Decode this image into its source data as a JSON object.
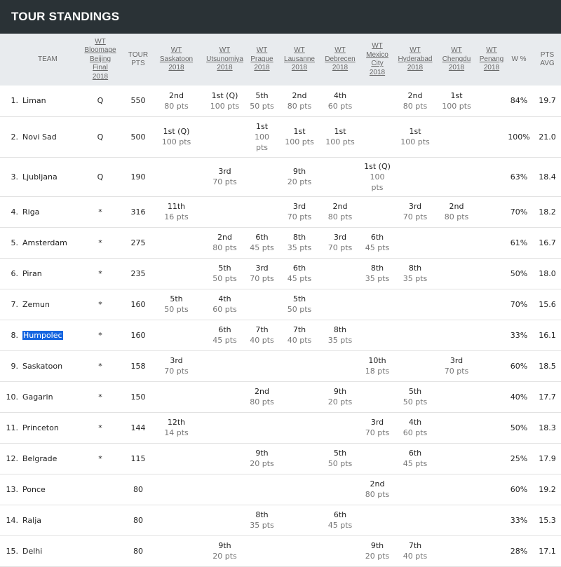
{
  "title": "TOUR STANDINGS",
  "columns": {
    "team": "TEAM",
    "bloomage": [
      "WT",
      "Bloomage",
      "Beijing",
      "Final",
      "2018"
    ],
    "tour_pts": [
      "TOUR",
      "PTS"
    ],
    "events": [
      [
        "WT",
        "Saskatoon",
        "2018"
      ],
      [
        "WT",
        "Utsunomiya",
        "2018"
      ],
      [
        "WT",
        "Prague",
        "2018"
      ],
      [
        "WT",
        "Lausanne",
        "2018"
      ],
      [
        "WT",
        "Debrecen",
        "2018"
      ],
      [
        "WT",
        "Mexico",
        "City",
        "2018"
      ],
      [
        "WT",
        "Hyderabad",
        "2018"
      ],
      [
        "WT",
        "Chengdu",
        "2018"
      ],
      [
        "WT",
        "Penang",
        "2018"
      ]
    ],
    "win_pct": "W %",
    "pts_avg": [
      "PTS",
      "AVG"
    ]
  },
  "rows": [
    {
      "rank": "1.",
      "team": "Liman",
      "q": "Q",
      "tour": "550",
      "ev": [
        [
          "2nd",
          "80 pts"
        ],
        [
          "1st (Q)",
          "100 pts"
        ],
        [
          "5th",
          "50 pts"
        ],
        [
          "2nd",
          "80 pts"
        ],
        [
          "4th",
          "60 pts"
        ],
        null,
        [
          "2nd",
          "80 pts"
        ],
        [
          "1st",
          "100 pts"
        ],
        null
      ],
      "w": "84%",
      "avg": "19.7"
    },
    {
      "rank": "2.",
      "team": "Novi Sad",
      "q": "Q",
      "tour": "500",
      "ev": [
        [
          "1st (Q)",
          "100 pts"
        ],
        null,
        [
          "1st",
          "100",
          "pts"
        ],
        [
          "1st",
          "100 pts"
        ],
        [
          "1st",
          "100 pts"
        ],
        null,
        [
          "1st",
          "100 pts"
        ],
        null,
        null
      ],
      "w": "100%",
      "avg": "21.0"
    },
    {
      "rank": "3.",
      "team": "Ljubljana",
      "q": "Q",
      "tour": "190",
      "ev": [
        null,
        [
          "3rd",
          "70 pts"
        ],
        null,
        [
          "9th",
          "20 pts"
        ],
        null,
        [
          "1st (Q)",
          "100",
          "pts"
        ],
        null,
        null,
        null
      ],
      "w": "63%",
      "avg": "18.4"
    },
    {
      "rank": "4.",
      "team": "Riga",
      "q": "*",
      "tour": "316",
      "ev": [
        [
          "11th",
          "16 pts"
        ],
        null,
        null,
        [
          "3rd",
          "70 pts"
        ],
        [
          "2nd",
          "80 pts"
        ],
        null,
        [
          "3rd",
          "70 pts"
        ],
        [
          "2nd",
          "80 pts"
        ],
        null
      ],
      "w": "70%",
      "avg": "18.2"
    },
    {
      "rank": "5.",
      "team": "Amsterdam",
      "q": "*",
      "tour": "275",
      "ev": [
        null,
        [
          "2nd",
          "80 pts"
        ],
        [
          "6th",
          "45 pts"
        ],
        [
          "8th",
          "35 pts"
        ],
        [
          "3rd",
          "70 pts"
        ],
        [
          "6th",
          "45 pts"
        ],
        null,
        null,
        null
      ],
      "w": "61%",
      "avg": "16.7"
    },
    {
      "rank": "6.",
      "team": "Piran",
      "q": "*",
      "tour": "235",
      "ev": [
        null,
        [
          "5th",
          "50 pts"
        ],
        [
          "3rd",
          "70 pts"
        ],
        [
          "6th",
          "45 pts"
        ],
        null,
        [
          "8th",
          "35 pts"
        ],
        [
          "8th",
          "35 pts"
        ],
        null,
        null
      ],
      "w": "50%",
      "avg": "18.0"
    },
    {
      "rank": "7.",
      "team": "Zemun",
      "q": "*",
      "tour": "160",
      "ev": [
        [
          "5th",
          "50 pts"
        ],
        [
          "4th",
          "60 pts"
        ],
        null,
        [
          "5th",
          "50 pts"
        ],
        null,
        null,
        null,
        null,
        null
      ],
      "w": "70%",
      "avg": "15.6"
    },
    {
      "rank": "8.",
      "team": "Humpolec",
      "q": "*",
      "tour": "160",
      "ev": [
        null,
        [
          "6th",
          "45 pts"
        ],
        [
          "7th",
          "40 pts"
        ],
        [
          "7th",
          "40 pts"
        ],
        [
          "8th",
          "35 pts"
        ],
        null,
        null,
        null,
        null
      ],
      "w": "33%",
      "avg": "16.1"
    },
    {
      "rank": "9.",
      "team": "Saskatoon",
      "q": "*",
      "tour": "158",
      "ev": [
        [
          "3rd",
          "70 pts"
        ],
        null,
        null,
        null,
        null,
        [
          "10th",
          "18 pts"
        ],
        null,
        [
          "3rd",
          "70 pts"
        ],
        null
      ],
      "w": "60%",
      "avg": "18.5"
    },
    {
      "rank": "10.",
      "team": "Gagarin",
      "q": "*",
      "tour": "150",
      "ev": [
        null,
        null,
        [
          "2nd",
          "80 pts"
        ],
        null,
        [
          "9th",
          "20 pts"
        ],
        null,
        [
          "5th",
          "50 pts"
        ],
        null,
        null
      ],
      "w": "40%",
      "avg": "17.7"
    },
    {
      "rank": "11.",
      "team": "Princeton",
      "q": "*",
      "tour": "144",
      "ev": [
        [
          "12th",
          "14 pts"
        ],
        null,
        null,
        null,
        null,
        [
          "3rd",
          "70 pts"
        ],
        [
          "4th",
          "60 pts"
        ],
        null,
        null
      ],
      "w": "50%",
      "avg": "18.3"
    },
    {
      "rank": "12.",
      "team": "Belgrade",
      "q": "*",
      "tour": "115",
      "ev": [
        null,
        null,
        [
          "9th",
          "20 pts"
        ],
        null,
        [
          "5th",
          "50 pts"
        ],
        null,
        [
          "6th",
          "45 pts"
        ],
        null,
        null
      ],
      "w": "25%",
      "avg": "17.9"
    },
    {
      "rank": "13.",
      "team": "Ponce",
      "q": "",
      "tour": "80",
      "ev": [
        null,
        null,
        null,
        null,
        null,
        [
          "2nd",
          "80 pts"
        ],
        null,
        null,
        null
      ],
      "w": "60%",
      "avg": "19.2"
    },
    {
      "rank": "14.",
      "team": "Ralja",
      "q": "",
      "tour": "80",
      "ev": [
        null,
        null,
        [
          "8th",
          "35 pts"
        ],
        null,
        [
          "6th",
          "45 pts"
        ],
        null,
        null,
        null,
        null
      ],
      "w": "33%",
      "avg": "15.3"
    },
    {
      "rank": "15.",
      "team": "Delhi",
      "q": "",
      "tour": "80",
      "ev": [
        null,
        [
          "9th",
          "20 pts"
        ],
        null,
        null,
        null,
        [
          "9th",
          "20 pts"
        ],
        [
          "7th",
          "40 pts"
        ],
        null,
        null
      ],
      "w": "28%",
      "avg": "17.1"
    }
  ],
  "highlighted_team": "Humpolec",
  "colors": {
    "header_bar": "#2a3236",
    "table_header": "#e8ebee",
    "highlight": "#1565e0"
  }
}
